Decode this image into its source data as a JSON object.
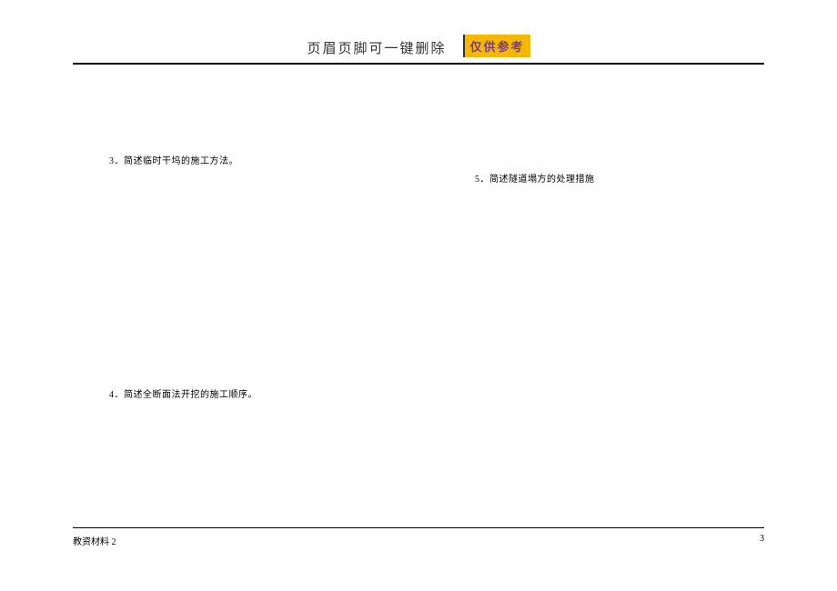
{
  "header": {
    "text": "页眉页脚可一键删除",
    "badge": "仅供参考"
  },
  "questions": {
    "q3": "3．简述临时干坞的施工方法。",
    "q4": "4．简述全断面法开挖的施工顺序。",
    "q5": "5．简述隧道塌方的处理措施"
  },
  "footer": {
    "left": "教资材料 2",
    "right": "3"
  }
}
